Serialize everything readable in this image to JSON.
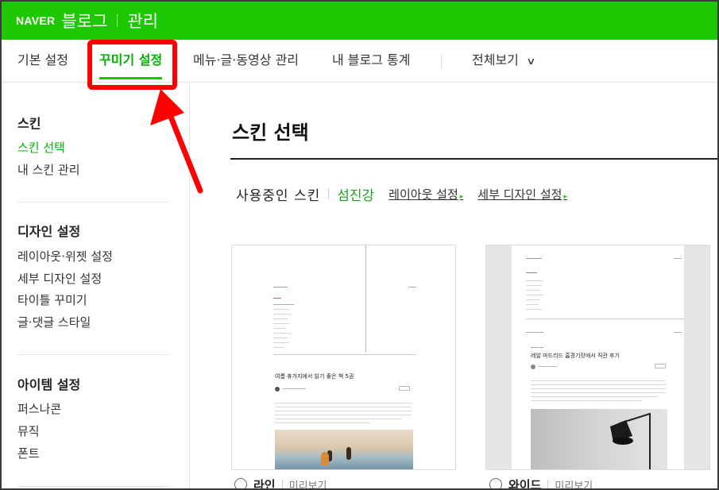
{
  "header": {
    "logo": "NAVER",
    "service": "블로그",
    "section": "관리",
    "bg_color": "#1ec800"
  },
  "tabs": [
    {
      "label": "기본 설정",
      "active": false
    },
    {
      "label": "꾸미기 설정",
      "active": true
    },
    {
      "label": "메뉴·글·동영상 관리",
      "active": false
    },
    {
      "label": "내 블로그 통계",
      "active": false
    },
    {
      "label": "전체보기",
      "active": false,
      "icon": "chevron-down-icon"
    }
  ],
  "sidebar": {
    "groups": [
      {
        "title": "스킨",
        "items": [
          {
            "label": "스킨 선택",
            "active": true
          },
          {
            "label": "내 스킨 관리",
            "active": false
          }
        ]
      },
      {
        "title": "디자인 설정",
        "items": [
          {
            "label": "레이아웃·위젯 설정",
            "active": false
          },
          {
            "label": "세부 디자인 설정",
            "active": false
          },
          {
            "label": "타이틀 꾸미기",
            "active": false
          },
          {
            "label": "글·댓글 스타일",
            "active": false
          }
        ]
      },
      {
        "title": "아이템 설정",
        "items": [
          {
            "label": "퍼스나콘",
            "active": false
          },
          {
            "label": "뮤직",
            "active": false
          },
          {
            "label": "폰트",
            "active": false
          }
        ]
      }
    ]
  },
  "main": {
    "title": "스킨 선택",
    "usage_label": "사용중인 스킨",
    "current_skin": "섬진강",
    "links": [
      "레이아웃 설정",
      "세부 디자인 설정"
    ]
  },
  "skins": [
    {
      "name": "라인",
      "preview_label": "미리보기",
      "thumb_post_title": "여름 휴가지에서 읽기 좋은 책 5권"
    },
    {
      "name": "와이드",
      "preview_label": "미리보기",
      "thumb_post_title": "레알 마드리드 홈경기장에서 직관 후기"
    }
  ],
  "annotation": {
    "color": "#ff0000",
    "target": "tab-decorate-settings"
  }
}
